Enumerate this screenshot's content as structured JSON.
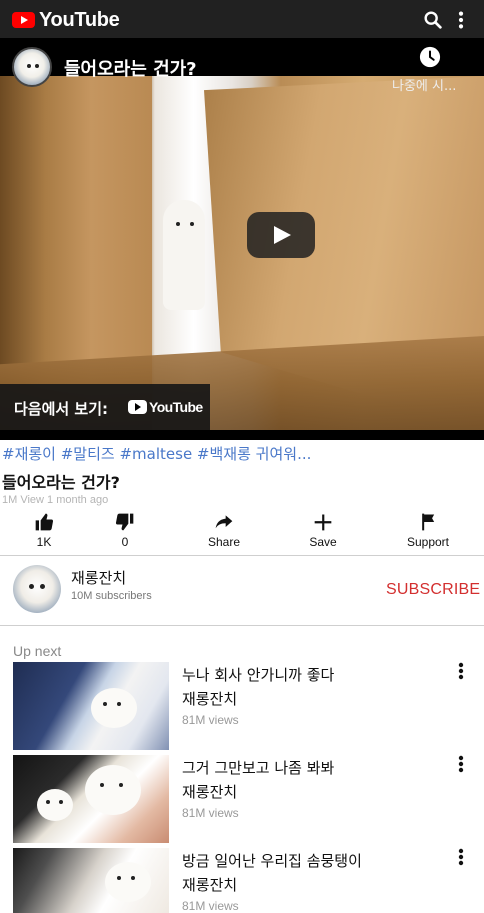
{
  "topbar": {
    "brand": "YouTube",
    "icons": {
      "search": "search-icon",
      "more": "more-vert-icon"
    },
    "colors": {
      "background": "#212121",
      "logo_red": "#ff0000"
    }
  },
  "player": {
    "title": "들어오라는 건가?",
    "watch_later_label": "나중에 시...",
    "watch_on_label": "다음에서 보기:",
    "watch_on_brand": "YouTube"
  },
  "video": {
    "hashtags": "#재롱이 #말티즈 #maltese #백재롱 귀여워...",
    "title": "들어오라는 건가?",
    "meta": "1M View 1 month ago",
    "hashtag_color": "#4a78c9"
  },
  "actions": [
    {
      "label": "1K",
      "icon": "thumbs-up-icon"
    },
    {
      "label": "0",
      "icon": "thumbs-down-icon"
    },
    {
      "label": "Share",
      "icon": "share-icon"
    },
    {
      "label": "Save",
      "icon": "plus-icon"
    },
    {
      "label": "Support",
      "icon": "flag-icon"
    }
  ],
  "channel": {
    "name": "재롱잔치",
    "subscribers": "10M subscribers",
    "subscribe_label": "SUBSCRIBE",
    "subscribe_color": "#d32f2f"
  },
  "up_next": {
    "heading": "Up next",
    "items": [
      {
        "title": "누나 회사 안가니까 좋다",
        "channel": "재롱잔치",
        "views": "81M views"
      },
      {
        "title": "그거 그만보고 나좀 봐봐",
        "channel": "재롱잔치",
        "views": "81M views"
      },
      {
        "title": "방금 일어난 우리집 솜뭉탱이",
        "channel": "재롱잔치",
        "views": "81M views"
      }
    ]
  }
}
